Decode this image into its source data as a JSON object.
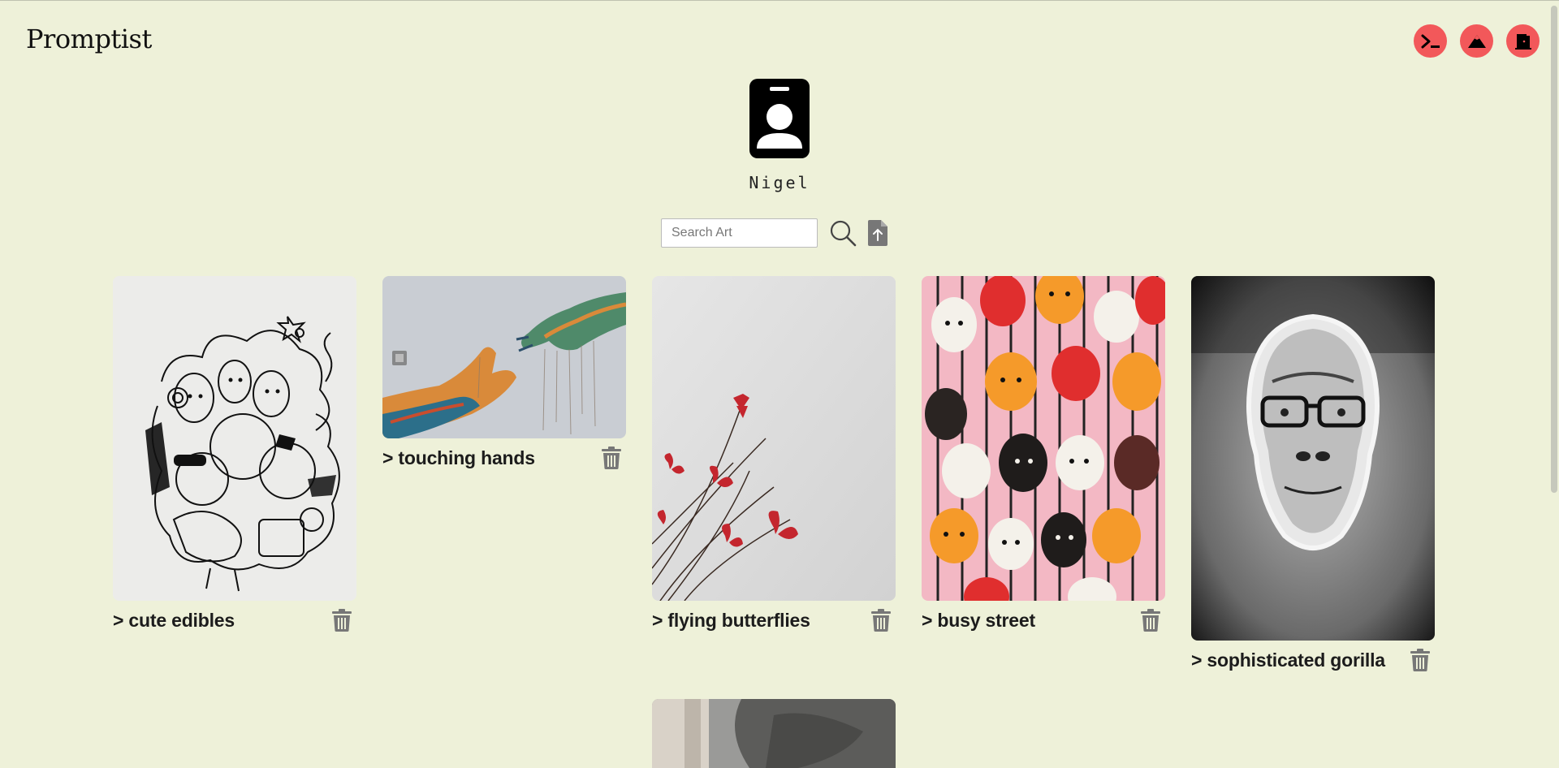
{
  "header": {
    "logo": "Promptist"
  },
  "actions": [
    {
      "name": "terminal-icon"
    },
    {
      "name": "mountain-icon"
    },
    {
      "name": "logout-door-icon"
    }
  ],
  "profile": {
    "avatar_icon": "id-badge-icon",
    "username": "Nigel"
  },
  "search": {
    "placeholder": "Search Art",
    "value": ""
  },
  "gallery": [
    {
      "caption": "> cute edibles"
    },
    {
      "caption": "> touching hands"
    },
    {
      "caption": "> flying butterflies"
    },
    {
      "caption": "> busy street"
    },
    {
      "caption": "> sophisticated gorilla"
    }
  ],
  "colors": {
    "background": "#eef1d9",
    "accent": "#f2585a",
    "icon_gray": "#777777"
  }
}
